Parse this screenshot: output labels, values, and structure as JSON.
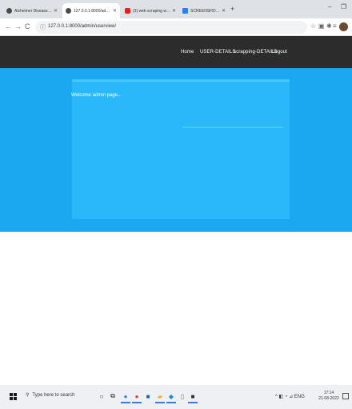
{
  "browser": {
    "tabs": [
      {
        "label": "Alzheimer Disease Prediction u",
        "color": "#4a4a4a",
        "active": false
      },
      {
        "label": "127.0.0.1:8000/admin/userview/",
        "color": "#4a4a4a",
        "active": true
      },
      {
        "label": "(3) web scraping with python",
        "color": "#e02020",
        "active": false
      },
      {
        "label": "SCREENSHOTS - Google Docs",
        "color": "#2f7df6",
        "active": false
      }
    ],
    "new_tab": "+",
    "window_controls": {
      "minimize": "–",
      "restore": "❐"
    },
    "back": "←",
    "forward": "→",
    "reload": "C",
    "url": "127.0.0.1:8000/admin/userview/"
  },
  "site_nav": {
    "links": [
      "Home",
      "USER-DETAILS",
      "scrapping-DETAILS",
      "Logout"
    ]
  },
  "content": {
    "welcome": "Welcome admin page..."
  },
  "taskbar": {
    "search_placeholder": "Type here to search",
    "tray_text": "^  ◧  ◔  ⊿  ENG",
    "time": "17:14",
    "date": "21-08-2022"
  },
  "colors": {
    "nav_bg": "#2c2c2c",
    "hero_bg": "#1ba8f0",
    "panel_bg": "#29b8fa"
  }
}
